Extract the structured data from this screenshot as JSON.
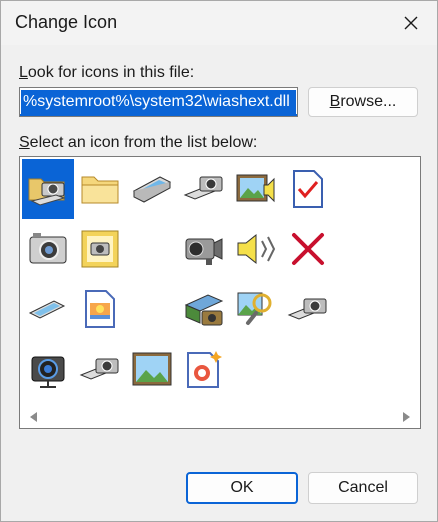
{
  "dialog": {
    "title": "Change Icon"
  },
  "file_section": {
    "label_access_key": "L",
    "label_rest": "ook for icons in this file:",
    "path_value": "%systemroot%\\system32\\wiashext.dll",
    "browse_label_access": "B",
    "browse_label_rest": "rowse..."
  },
  "list_section": {
    "label_access_key": "S",
    "label_rest": "elect an icon from the list below:"
  },
  "icons": [
    {
      "name": "camera-folder-icon",
      "selected": true
    },
    {
      "name": "folder-icon"
    },
    {
      "name": "scanner-icon"
    },
    {
      "name": "camera-scanner-icon"
    },
    {
      "name": "picture-speaker-icon"
    },
    {
      "name": "document-check-icon"
    },
    {
      "name": "digital-camera-icon"
    },
    {
      "name": "camera-document-icon"
    },
    {
      "name": "video-camera-icon"
    },
    {
      "name": "speaker-icon"
    },
    {
      "name": "red-x-icon"
    },
    {
      "name": "scanner-small-icon"
    },
    {
      "name": "photo-document-icon"
    },
    {
      "name": "scanner-camera-icon"
    },
    {
      "name": "photo-search-icon"
    },
    {
      "name": "camera-scanner-small-icon"
    },
    {
      "name": "camcorder-icon"
    },
    {
      "name": "camera-scanner-alt-icon"
    },
    {
      "name": "landscape-picture-icon"
    },
    {
      "name": "new-photo-icon"
    }
  ],
  "footer": {
    "ok_label": "OK",
    "cancel_label": "Cancel"
  }
}
